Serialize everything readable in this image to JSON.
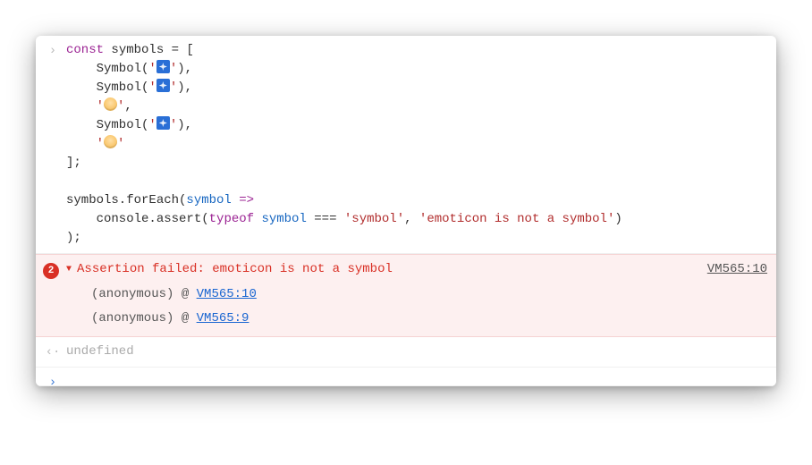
{
  "input": {
    "lines": [
      {
        "segments": [
          {
            "t": "const ",
            "c": "kw-const"
          },
          {
            "t": "symbols = [",
            "c": ""
          }
        ]
      },
      {
        "segments": [
          {
            "t": "    Symbol(",
            "c": ""
          },
          {
            "t": "'",
            "c": "str"
          },
          {
            "emoji": "box"
          },
          {
            "t": "'",
            "c": "str"
          },
          {
            "t": "),",
            "c": ""
          }
        ]
      },
      {
        "segments": [
          {
            "t": "    Symbol(",
            "c": ""
          },
          {
            "t": "'",
            "c": "str"
          },
          {
            "emoji": "box"
          },
          {
            "t": "'",
            "c": "str"
          },
          {
            "t": "),",
            "c": ""
          }
        ]
      },
      {
        "segments": [
          {
            "t": "    ",
            "c": ""
          },
          {
            "t": "'",
            "c": "str"
          },
          {
            "emoji": "face"
          },
          {
            "t": "'",
            "c": "str"
          },
          {
            "t": ",",
            "c": ""
          }
        ]
      },
      {
        "segments": [
          {
            "t": "    Symbol(",
            "c": ""
          },
          {
            "t": "'",
            "c": "str"
          },
          {
            "emoji": "box"
          },
          {
            "t": "'",
            "c": "str"
          },
          {
            "t": "),",
            "c": ""
          }
        ]
      },
      {
        "segments": [
          {
            "t": "    ",
            "c": ""
          },
          {
            "t": "'",
            "c": "str"
          },
          {
            "emoji": "face"
          },
          {
            "t": "'",
            "c": "str"
          }
        ]
      },
      {
        "segments": [
          {
            "t": "];",
            "c": ""
          }
        ]
      },
      {
        "segments": [
          {
            "t": "",
            "c": ""
          }
        ]
      },
      {
        "segments": [
          {
            "t": "symbols.forEach(",
            "c": ""
          },
          {
            "t": "symbol",
            "c": "param"
          },
          {
            "t": " =>",
            "c": "kw-op"
          }
        ]
      },
      {
        "segments": [
          {
            "t": "    console.assert(",
            "c": ""
          },
          {
            "t": "typeof ",
            "c": "kw-op"
          },
          {
            "t": "symbol",
            "c": "param"
          },
          {
            "t": " === ",
            "c": ""
          },
          {
            "t": "'symbol'",
            "c": "str"
          },
          {
            "t": ", ",
            "c": ""
          },
          {
            "t": "'emoticon is not a symbol'",
            "c": "str"
          },
          {
            "t": ")",
            "c": ""
          }
        ]
      },
      {
        "segments": [
          {
            "t": ");",
            "c": ""
          }
        ]
      }
    ]
  },
  "error": {
    "count": "2",
    "message": "Assertion failed: emoticon is not a symbol",
    "source": "VM565:10",
    "stack": [
      {
        "fn": "(anonymous)",
        "at": "@",
        "loc": "VM565:10"
      },
      {
        "fn": "(anonymous)",
        "at": "@",
        "loc": "VM565:9"
      }
    ]
  },
  "output": {
    "value": "undefined"
  },
  "glyphs": {
    "input_prompt": "›",
    "output_prompt": "‹·",
    "disclose": "▼"
  }
}
